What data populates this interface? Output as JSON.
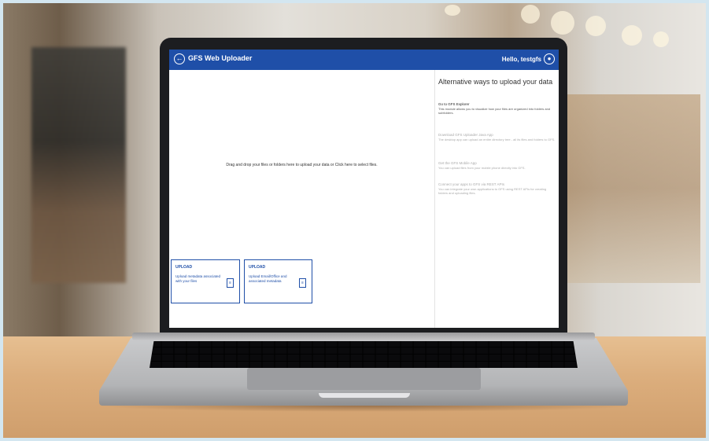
{
  "app": {
    "title": "GFS Web Uploader",
    "greeting": "Hello, testgfs",
    "back_icon": "back-arrow-icon",
    "user_icon": "user-circle-icon",
    "brand_color": "#1f4fa8"
  },
  "dropzone": {
    "text": "Drag and drop your files or folders here to upload your data or Click here to select files."
  },
  "cards": [
    {
      "heading": "UPLOAD",
      "body": "Upload metadata associated with your files",
      "icon": "document-icon"
    },
    {
      "heading": "UPLOAD",
      "body": "Upload Email/Office and associated metadata",
      "icon": "document-icon"
    }
  ],
  "sidebar": {
    "title": "Alternative ways to upload your data",
    "items": [
      {
        "heading": "Go to GFS Explorer",
        "desc": "This module allows you to visualize how your files are organized into folders and subfolders."
      },
      {
        "heading": "Download GFS Uploader Java App",
        "desc": "The desktop app can upload an entire directory tree - all its files and folders to GFS."
      },
      {
        "heading": "Get the GFS Mobile App",
        "desc": "You can upload files from your mobile phone directly into GFS."
      },
      {
        "heading": "Connect your apps to GFS via REST APIs",
        "desc": "You can integrate your own applications to GFS using REST APIs for creating folders and uploading files."
      }
    ]
  }
}
